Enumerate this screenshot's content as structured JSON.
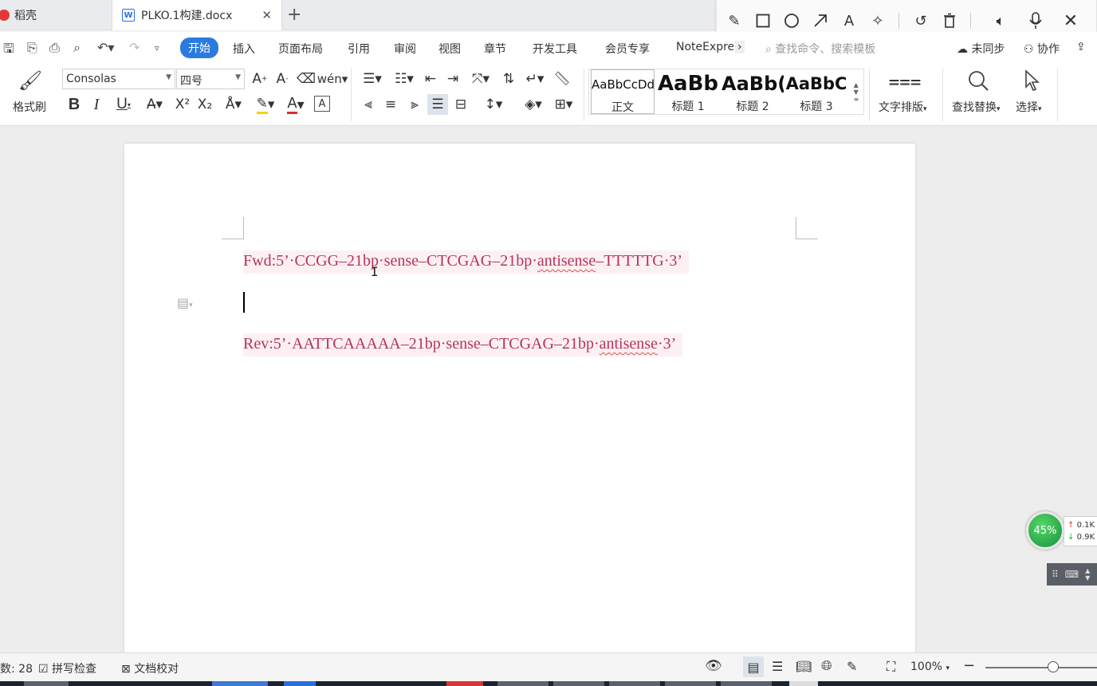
{
  "tabs": [
    {
      "label": "稻壳"
    },
    {
      "label": "PLKO.1构建.docx"
    }
  ],
  "menu": {
    "items": [
      "开始",
      "插入",
      "页面布局",
      "引用",
      "审阅",
      "视图",
      "章节",
      "开发工具",
      "会员专享",
      "NoteExpre"
    ],
    "search_placeholder": "查找命令、搜索模板",
    "sync": "未同步",
    "collab": "协作"
  },
  "ribbon": {
    "format_painter": "格式刷",
    "font_name": "Consolas",
    "font_size": "四号",
    "bold": "B",
    "italic": "I",
    "underline": "U",
    "styles": [
      {
        "preview": "AaBbCcDd",
        "caption": "正文"
      },
      {
        "preview": "AaBb",
        "caption": "标题 1"
      },
      {
        "preview": "AaBb(",
        "caption": "标题 2"
      },
      {
        "preview": "AaBbC",
        "caption": "标题 3"
      }
    ],
    "text_layout": "文字排版",
    "find_replace": "查找替换",
    "select": "选择"
  },
  "document": {
    "fwd_prefix": "Fwd:5’·CCGG–21bp·sense–CTCGAG–21bp·",
    "fwd_wavy": "antisense",
    "fwd_suffix": "–TTTTTG·3’",
    "rev_prefix": "Rev:5’·AATTCAAAAA–21bp·sense–CTCGAG–21bp·",
    "rev_wavy": "antisense",
    "rev_suffix": "·3’"
  },
  "widgets": {
    "cpu_percent": "45%",
    "net_up": "0.1K",
    "net_down": "0.9K"
  },
  "status": {
    "word_count": "数: 28",
    "spell_check": "拼写检查",
    "doc_proof": "文档校对",
    "zoom": "100%"
  }
}
